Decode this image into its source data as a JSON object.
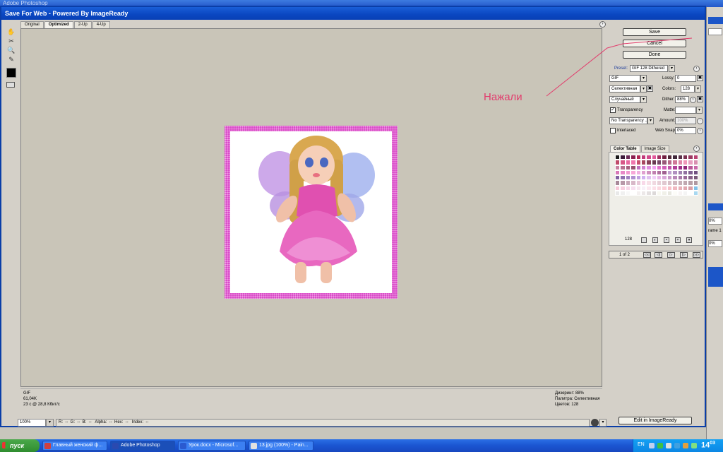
{
  "background_app": {
    "title": "Adobe Photoshop"
  },
  "dialog": {
    "title": "Save For Web - Powered By ImageReady",
    "tabs": [
      "Original",
      "Optimized",
      "2-Up",
      "4-Up"
    ],
    "active_tab": "Optimized"
  },
  "buttons": {
    "save": "Save",
    "cancel": "Cancel",
    "done": "Done",
    "edit_in_imageready": "Edit in ImageReady"
  },
  "settings": {
    "preset_label": "Preset:",
    "preset_value": "GIF 128 Dithered",
    "format": "GIF",
    "lossy_label": "Lossy:",
    "lossy_value": "0",
    "reduction": "Селективная",
    "colors_label": "Colors:",
    "colors_value": "128",
    "dither_algo": "Случайный",
    "dither_label": "Dither:",
    "dither_value": "88%",
    "transparency_label": "Transparency",
    "transparency_checked": true,
    "matte_label": "Matte:",
    "transparency_dither": "No Transparency ...",
    "amount_label": "Amount:",
    "amount_value": "100%",
    "interlaced_label": "Interlaced",
    "interlaced_checked": false,
    "websnap_label": "Web Snap:",
    "websnap_value": "0%"
  },
  "color_table": {
    "tabs": [
      "Color Table",
      "Image Size"
    ],
    "active_tab": "Color Table",
    "count": "128",
    "swatches": [
      "#1a1a1a",
      "#3d1a3a",
      "#6a2a55",
      "#8b2050",
      "#b02a55",
      "#c13a7a",
      "#d04a8a",
      "#e05a9a",
      "#a03060",
      "#702040",
      "#502838",
      "#40283a",
      "#5a3048",
      "#7a3050",
      "#9a3860",
      "#b84070",
      "#c04a6a",
      "#d85888",
      "#e868a0",
      "#f078b0",
      "#c85070",
      "#a84860",
      "#884058",
      "#683850",
      "#784868",
      "#985878",
      "#b86888",
      "#d07898",
      "#e088a8",
      "#f098b8",
      "#e8a0c0",
      "#d890b0",
      "#c880a0",
      "#b87090",
      "#a86080",
      "#985070",
      "#c070c0",
      "#d080d0",
      "#e090e0",
      "#f0a0f0",
      "#e070c8",
      "#d060b8",
      "#c050a8",
      "#b04098",
      "#a03088",
      "#902878",
      "#b85898",
      "#c868a8",
      "#d878b8",
      "#e888c8",
      "#f098d0",
      "#f8a8d8",
      "#f0b0e0",
      "#e0a0d0",
      "#d090c0",
      "#c080b0",
      "#b070a0",
      "#a06090",
      "#c0a0d0",
      "#b090c0",
      "#a080b0",
      "#9070a0",
      "#806090",
      "#705080",
      "#8060a0",
      "#9070b0",
      "#a080c0",
      "#b090d0",
      "#c0a0e0",
      "#d0b0f0",
      "#e0c0f0",
      "#f0d0f8",
      "#e8b8e8",
      "#d8a8d8",
      "#c898c8",
      "#b888b8",
      "#a878a8",
      "#986898",
      "#886088",
      "#785878",
      "#a88898",
      "#b898a8",
      "#c8a8b8",
      "#d8b8c8",
      "#e8c8d8",
      "#f8d8e8",
      "#f8e0e8",
      "#f0d8e0",
      "#e8d0d8",
      "#e0c8d0",
      "#d8c0c8",
      "#d0b8c0",
      "#c8b0b8",
      "#c0a8b0",
      "#b8a0a8",
      "#b098a0",
      "#f8c8d8",
      "#f8d0e0",
      "#f8d8e8",
      "#f8e0f0",
      "#f8e8f0",
      "#f8f0f8",
      "#fce8f0",
      "#fce0e8",
      "#fcd8e0",
      "#fcd0d8",
      "#f8c0c8",
      "#f0b8c0",
      "#e8b0b8",
      "#e0a8b0",
      "#d8a0a8",
      "#80c0e8",
      "#e8e8e8",
      "#f0f0f0",
      "#f8f8f8",
      "#ffffff",
      "#f4f0f0",
      "#ece8e8",
      "#e4e0e0",
      "#dcd8d8",
      "#f8f8f0",
      "#f0f0e8",
      "#e8e8e0",
      "#fcfcf8",
      "#f8f4f4",
      "#f4f4f4",
      "#ffffff",
      "#a8d8f0"
    ]
  },
  "animation": {
    "frame_label": "1 of 2"
  },
  "status": {
    "left_lines": [
      "GIF",
      "61,04K",
      "23 с @ 28,8 Кбит/с"
    ],
    "right_lines": [
      "Дизеринг: 88%",
      "Палитра: Селективная",
      "Цветов: 128"
    ]
  },
  "bottom": {
    "zoom": "100%",
    "readouts": "R:  --  G:  --  B:  --   Alpha:  --  Hex:  --   Index:  --"
  },
  "annotation": {
    "text": "Нажали",
    "color": "#e23c6c"
  },
  "right_panel_peek": {
    "value1": "0%",
    "value2": "0%",
    "frame_text": "rame 1"
  },
  "taskbar": {
    "start_label": "пуск",
    "tasks": [
      {
        "label": "Главный женский ф...",
        "active": false,
        "icon_color": "#d04040"
      },
      {
        "label": "Adobe Photoshop",
        "active": true,
        "icon_color": "#2a4ab0"
      },
      {
        "label": "Урок.docx - Microsof...",
        "active": false,
        "icon_color": "#2a5ad0"
      },
      {
        "label": "13.jpg (100%) - Pain...",
        "active": false,
        "icon_color": "#e0e0e0"
      }
    ],
    "language": "EN",
    "time": "14",
    "time_sup": "03"
  }
}
